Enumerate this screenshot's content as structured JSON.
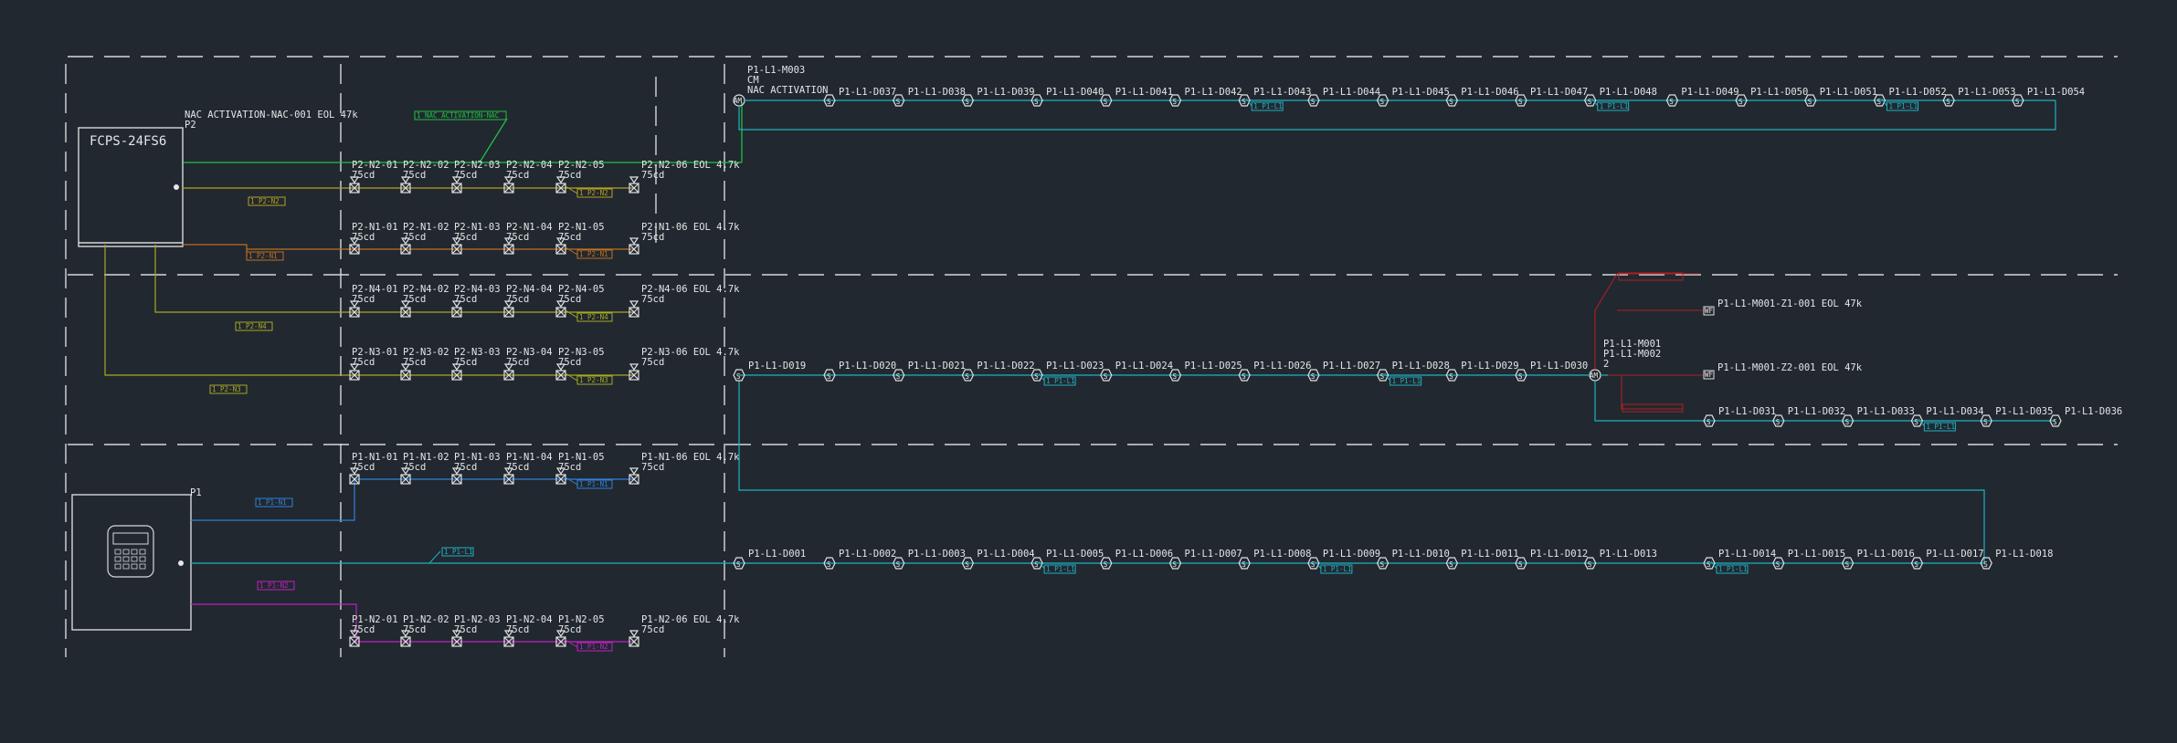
{
  "panels": {
    "p2_name": "FCPS-24FS6",
    "p2_tag": "P2",
    "p1_tag": "P1"
  },
  "nac_activation": {
    "text": "NAC ACTIVATION-NAC-001 EOL 47k",
    "p2": "P2",
    "green_tag": "1 NAC ACTIVATION-NAC"
  },
  "module_m003": {
    "line1": "P1-L1-M003",
    "line2": "CM",
    "line3": "NAC ACTIVATION",
    "sym": "AM"
  },
  "module_m001": {
    "line1": "P1-L1-M001",
    "line2": "P1-L1-M002",
    "line3": "2",
    "sym": "AM",
    "z1": "P1-L1-M001-Z1-001 EOL 47k",
    "z2": "P1-L1-M001-Z2-001 EOL 47k",
    "wf": "WF"
  },
  "nac_circuits": [
    {
      "id": "p2n2",
      "color": "#b8a020",
      "tag": "1 P2-N2",
      "tag2": "1 P2-N2",
      "devices": [
        "P2-N2-01",
        "P2-N2-02",
        "P2-N2-03",
        "P2-N2-04",
        "P2-N2-05"
      ],
      "eol": "P2-N2-06 EOL 4.7k",
      "sub": "75cd"
    },
    {
      "id": "p2n1",
      "color": "#c07020",
      "tag": "1 P2-N1",
      "tag2": "1 P2-N1",
      "devices": [
        "P2-N1-01",
        "P2-N1-02",
        "P2-N1-03",
        "P2-N1-04",
        "P2-N1-05"
      ],
      "eol": "P2-N1-06 EOL 4.7k",
      "sub": "75cd"
    },
    {
      "id": "p2n4",
      "color": "#a8a820",
      "tag": "1 P2-N4",
      "tag2": "1 P2-N4",
      "devices": [
        "P2-N4-01",
        "P2-N4-02",
        "P2-N4-03",
        "P2-N4-04",
        "P2-N4-05"
      ],
      "eol": "P2-N4-06 EOL 4.7k",
      "sub": "75cd"
    },
    {
      "id": "p2n3",
      "color": "#a8a820",
      "tag": "1 P2-N3",
      "tag2": "1 P2-N3",
      "devices": [
        "P2-N3-01",
        "P2-N3-02",
        "P2-N3-03",
        "P2-N3-04",
        "P2-N3-05"
      ],
      "eol": "P2-N3-06 EOL 4.7k",
      "sub": "75cd"
    },
    {
      "id": "p1n1",
      "color": "#3080d8",
      "tag": "1 P1-N1",
      "tag2": "1 P1-N1",
      "devices": [
        "P1-N1-01",
        "P1-N1-02",
        "P1-N1-03",
        "P1-N1-04",
        "P1-N1-05"
      ],
      "eol": "P1-N1-06 EOL 4.7k",
      "sub": "75cd"
    },
    {
      "id": "p1n2",
      "color": "#c020c0",
      "tag": "1 P1-N2",
      "tag2": "1 P1-N2",
      "devices": [
        "P1-N2-01",
        "P1-N2-02",
        "P1-N2-03",
        "P1-N2-04",
        "P1-N2-05"
      ],
      "eol": "P1-N2-06 EOL 4.7k",
      "sub": "75cd"
    }
  ],
  "slc": {
    "sym": "S",
    "loop_tag": "1 P1-L1",
    "row1": [
      "P1-L1-D037",
      "P1-L1-D038",
      "P1-L1-D039",
      "P1-L1-D040",
      "P1-L1-D041",
      "P1-L1-D042",
      "P1-L1-D043",
      "P1-L1-D044",
      "P1-L1-D045",
      "P1-L1-D046",
      "P1-L1-D047",
      "P1-L1-D048",
      "P1-L1-D049",
      "P1-L1-D050",
      "P1-L1-D051",
      "P1-L1-D052",
      "P1-L1-D053",
      "P1-L1-D054"
    ],
    "row2": [
      "P1-L1-D019",
      "P1-L1-D020",
      "P1-L1-D021",
      "P1-L1-D022",
      "P1-L1-D023",
      "P1-L1-D024",
      "P1-L1-D025",
      "P1-L1-D026",
      "P1-L1-D027",
      "P1-L1-D028",
      "P1-L1-D029",
      "P1-L1-D030"
    ],
    "row2b": [
      "P1-L1-D031",
      "P1-L1-D032",
      "P1-L1-D033",
      "P1-L1-D034",
      "P1-L1-D035",
      "P1-L1-D036"
    ],
    "row3": [
      "P1-L1-D001",
      "P1-L1-D002",
      "P1-L1-D003",
      "P1-L1-D004",
      "P1-L1-D005",
      "P1-L1-D006",
      "P1-L1-D007",
      "P1-L1-D008",
      "P1-L1-D009",
      "P1-L1-D010",
      "P1-L1-D011",
      "P1-L1-D012",
      "P1-L1-D013",
      "P1-L1-D014",
      "P1-L1-D015",
      "P1-L1-D016",
      "P1-L1-D017",
      "P1-L1-D018"
    ],
    "tagged_row1": [
      6,
      11,
      15
    ],
    "tagged_row1_wire": [
      0
    ],
    "tagged_row2": [
      0,
      4,
      9
    ],
    "tagged_row2b": [
      3
    ],
    "tagged_row3": [
      4,
      8,
      13
    ]
  },
  "colors": {
    "slc": "#20b0c0",
    "green": "#20c040",
    "red": "#b02020"
  }
}
